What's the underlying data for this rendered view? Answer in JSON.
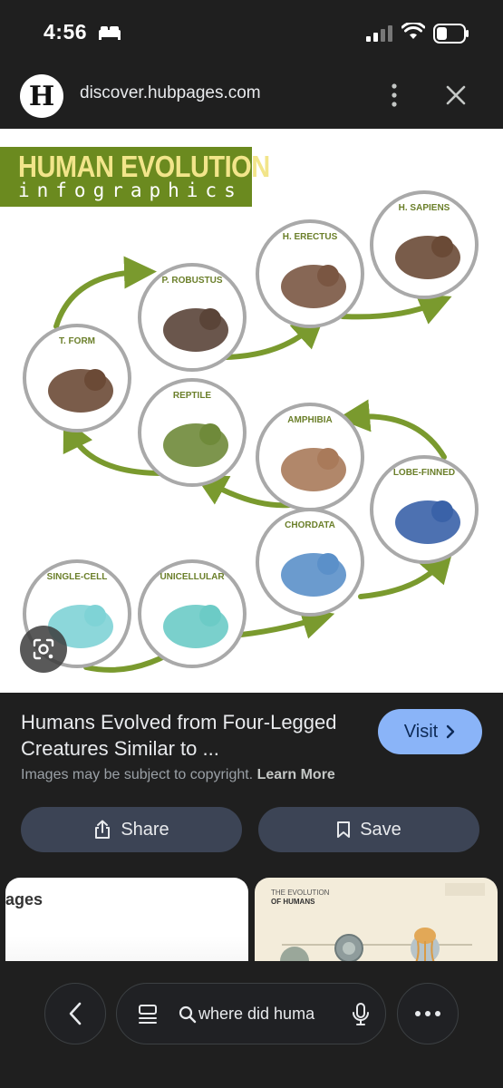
{
  "status_bar": {
    "time": "4:56"
  },
  "url_bar": {
    "url": "discover.hubpages.com",
    "logo_letter": "H"
  },
  "infographic": {
    "title_line1": "HUMAN EVOLUTION",
    "title_line2": "infographics",
    "stages": [
      {
        "label": "SINGLE-CELL"
      },
      {
        "label": "UNICELLULAR"
      },
      {
        "label": "CHORDATA"
      },
      {
        "label": "LOBE-FINNED"
      },
      {
        "label": "AMPHIBIA"
      },
      {
        "label": "REPTILE"
      },
      {
        "label": "T. FORM"
      },
      {
        "label": "P. ROBUSTUS"
      },
      {
        "label": "H. ERECTUS"
      },
      {
        "label": "H. SAPIENS"
      }
    ],
    "colors": {
      "banner": "#6b8a1f",
      "arrow": "#7a9a2e",
      "circle_border": "#a9a9a9"
    }
  },
  "result": {
    "title": "Humans Evolved from Four-Legged Creatures Similar to ...",
    "visit_label": "Visit",
    "copyright_text": "Images may be subject to copyright.",
    "learn_more_label": "Learn More"
  },
  "actions": {
    "share_label": "Share",
    "save_label": "Save"
  },
  "thumbnails": {
    "left_text": "ages",
    "right_title_line1": "THE EVOLUTION",
    "right_title_line2": "OF HUMANS"
  },
  "bottom_bar": {
    "query": "where did huma"
  },
  "icons": [
    "bed-icon",
    "signal-icon",
    "wifi-icon",
    "battery-icon",
    "kebab-icon",
    "close-icon",
    "google-lens-icon",
    "chevron-right-icon",
    "share-icon",
    "bookmark-icon",
    "back-arrow-icon",
    "lens-list-icon",
    "search-icon",
    "mic-icon",
    "more-dots-icon"
  ]
}
